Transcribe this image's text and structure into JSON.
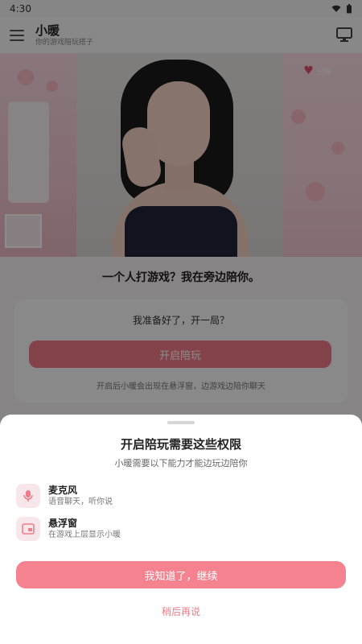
{
  "status_bar": {
    "time": "4:30"
  },
  "app_bar": {
    "title": "小暖",
    "subtitle": "你的游戏陪玩搭子",
    "menu_icon": "menu-icon",
    "cast_icon": "screen-icon"
  },
  "hero": {
    "favorite_icon": "heart-icon",
    "favorite_label": "已保"
  },
  "main": {
    "tagline": "一个人打游戏？我在旁边陪你。",
    "card": {
      "title": "我准备好了，开一局？",
      "button": "开启陪玩",
      "note": "开启后小暖会出现在悬浮窗，边游戏边陪你聊天"
    }
  },
  "sheet": {
    "title": "开启陪玩需要这些权限",
    "subtitle": "小暖需要以下能力才能边玩边陪你",
    "permissions": [
      {
        "icon": "microphone-icon",
        "title": "麦克风",
        "desc": "语音聊天，听你说"
      },
      {
        "icon": "floating-window-icon",
        "title": "悬浮窗",
        "desc": "在游戏上层显示小暖"
      }
    ],
    "primary_button": "我知道了，继续",
    "secondary_button": "稍后再说"
  },
  "colors": {
    "accent": "#f4828f",
    "accent_dark": "#f07a88",
    "icon_bg": "#f8e7ea"
  }
}
